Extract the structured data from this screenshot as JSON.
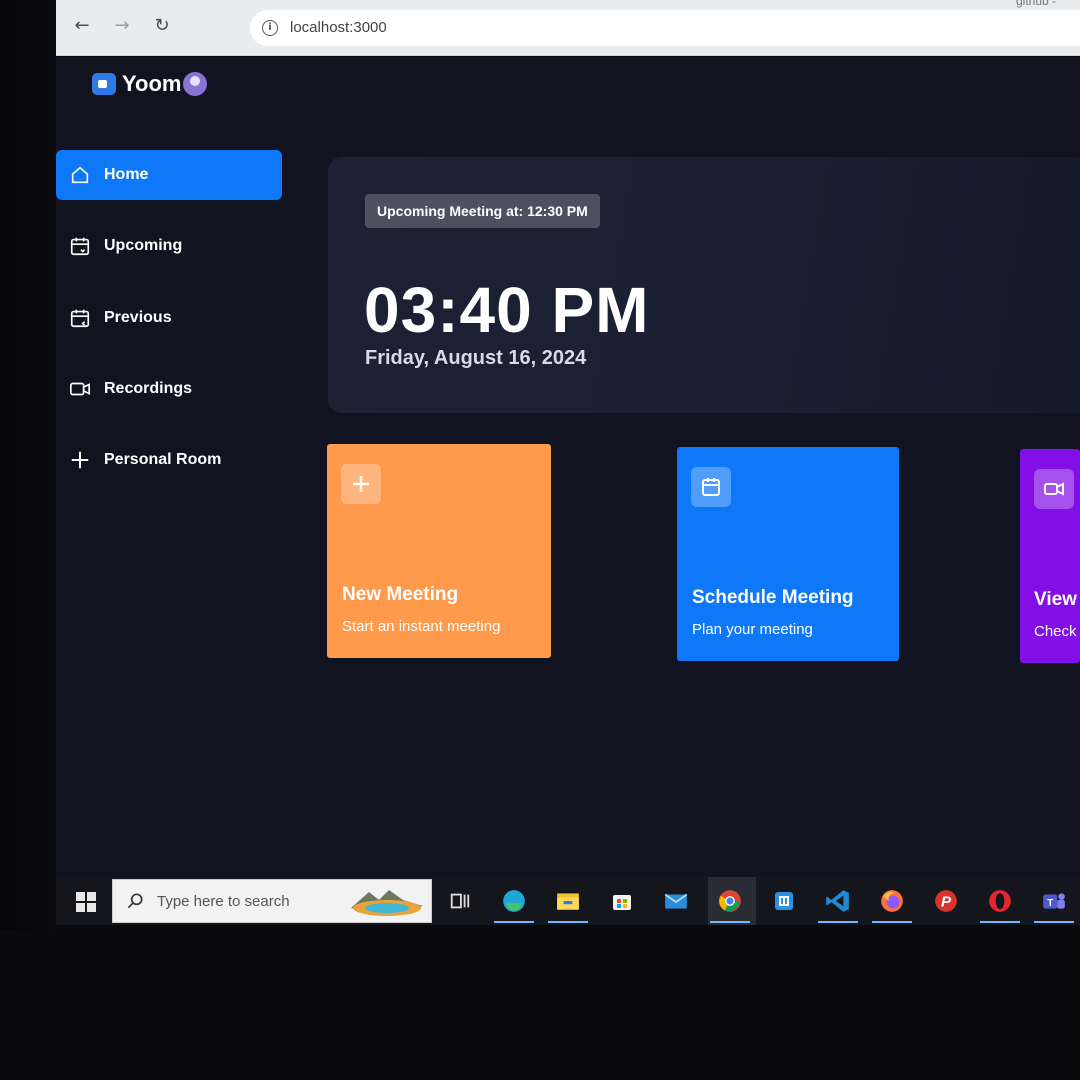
{
  "browser": {
    "url": "localhost:3000",
    "tab_hint": "github - UNDO"
  },
  "app": {
    "name": "Yoom"
  },
  "sidebar": {
    "items": [
      {
        "label": "Home",
        "icon": "home-icon",
        "active": true
      },
      {
        "label": "Upcoming",
        "icon": "calendar-forward-icon",
        "active": false
      },
      {
        "label": "Previous",
        "icon": "calendar-back-icon",
        "active": false
      },
      {
        "label": "Recordings",
        "icon": "video-icon",
        "active": false
      },
      {
        "label": "Personal Room",
        "icon": "plus-icon",
        "active": false
      }
    ]
  },
  "hero": {
    "upcoming_label": "Upcoming Meeting at: 12:30 PM",
    "time": "03:40 PM",
    "date": "Friday, August 16, 2024"
  },
  "cards": [
    {
      "title": "New Meeting",
      "subtitle": "Start an instant meeting",
      "icon": "plus-icon",
      "color": "#ff9a4d"
    },
    {
      "title": "Schedule Meeting",
      "subtitle": "Plan your meeting",
      "icon": "calendar-icon",
      "color": "#0e78f9"
    },
    {
      "title": "View",
      "subtitle": "Check",
      "icon": "video-icon",
      "color": "#830ee6"
    }
  ],
  "taskbar": {
    "search_placeholder": "Type here to search",
    "icons": [
      "task-view-icon",
      "edge-icon",
      "file-explorer-icon",
      "store-icon",
      "mail-icon",
      "chrome-icon",
      "app-icon",
      "vscode-icon",
      "firefox-icon",
      "postman-icon",
      "opera-icon",
      "teams-icon"
    ]
  },
  "colors": {
    "accent_blue": "#0e78f9",
    "orange": "#ff9a4d",
    "purple": "#830ee6",
    "background": "#111420"
  }
}
